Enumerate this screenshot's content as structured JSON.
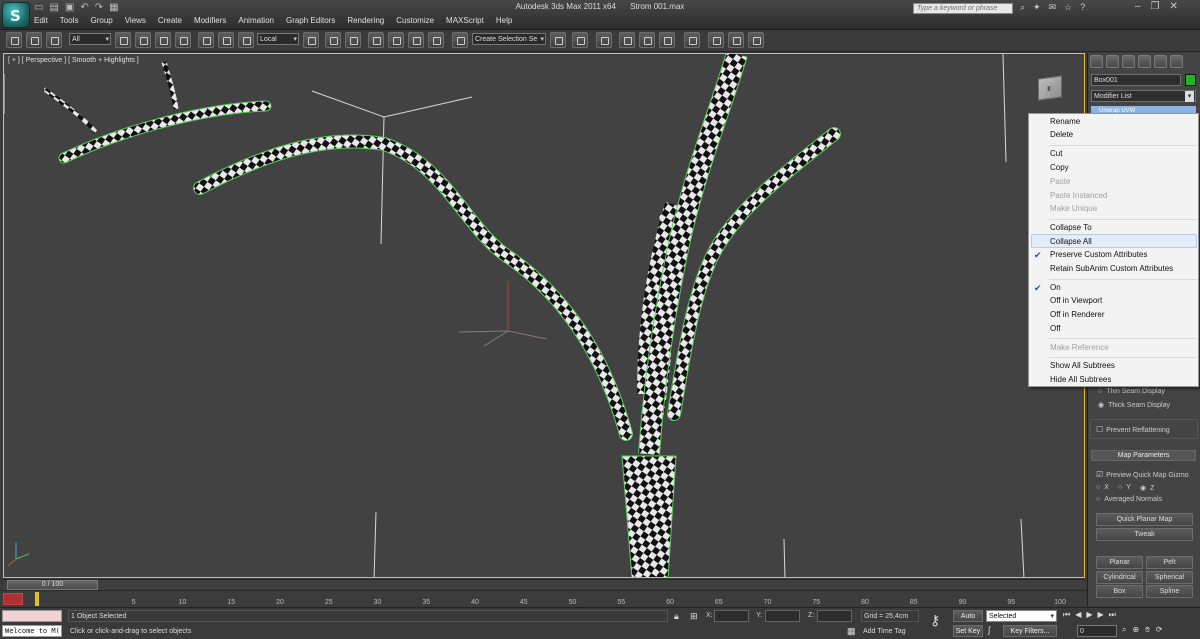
{
  "window": {
    "app_title": "Autodesk 3ds Max  2011 x64",
    "file_name": "Strom 001.max",
    "search_placeholder": "Type a keyword or phrase"
  },
  "menu": [
    "Edit",
    "Tools",
    "Group",
    "Views",
    "Create",
    "Modifiers",
    "Animation",
    "Graph Editors",
    "Rendering",
    "Customize",
    "MAXScript",
    "Help"
  ],
  "toolbar": {
    "selection_filter": "All",
    "reference_coord": "Local",
    "named_selection": "Create Selection Se"
  },
  "viewport": {
    "label": "[ + ] [ Perspective ] [ Smooth + Highlights ]"
  },
  "command_panel": {
    "object_name": "Box001",
    "object_color": "#22b422",
    "modifier_list": "Modifier List",
    "stack_item": "Unwrap UVW",
    "thin_seam": "Thin Seam Display",
    "thick_seam": "Thick Seam Display",
    "prevent_reflattening": "Prevent Reflattening",
    "map_parameters": "Map Parameters",
    "preview_gizmo": "Preview Quick Map Gizmo",
    "axis_x": "X",
    "axis_y": "Y",
    "axis_z": "Z",
    "averaged_normals": "Averaged Normals",
    "quick_planar_map": "Quick Planar Map",
    "tweak": "Tweak",
    "planar": "Planar",
    "pelt": "Pelt",
    "cylindrical": "Cylindrical",
    "spherical": "Spherical",
    "box": "Box",
    "spline": "Spline"
  },
  "context_menu": {
    "group1": [
      "Rename",
      "Delete"
    ],
    "group2": [
      {
        "label": "Cut",
        "disabled": false
      },
      {
        "label": "Copy",
        "disabled": false
      },
      {
        "label": "Paste",
        "disabled": true
      },
      {
        "label": "Paste Instanced",
        "disabled": true
      },
      {
        "label": "Make Unique",
        "disabled": true
      }
    ],
    "group3": [
      {
        "label": "Collapse To",
        "checked": false
      },
      {
        "label": "Collapse All",
        "checked": false
      },
      {
        "label": "Preserve Custom Attributes",
        "checked": true
      },
      {
        "label": "Retain SubAnim Custom Attributes",
        "checked": false
      }
    ],
    "group4": [
      {
        "label": "On",
        "checked": true
      },
      {
        "label": "Off in Viewport",
        "checked": false
      },
      {
        "label": "Off in Renderer",
        "checked": false
      },
      {
        "label": "Off",
        "checked": false
      }
    ],
    "make_reference": "Make Reference",
    "show_subtrees": "Show All Subtrees",
    "hide_subtrees": "Hide All Subtrees"
  },
  "timeline": {
    "time_slider": "0 / 100",
    "ticks": [
      "5",
      "10",
      "15",
      "20",
      "25",
      "30",
      "35",
      "40",
      "45",
      "50",
      "55",
      "60",
      "65",
      "70",
      "75",
      "80",
      "85",
      "90",
      "95",
      "100"
    ]
  },
  "status": {
    "maxscript_text": "Welcome to M(",
    "selected_count": "1 Object Selected",
    "prompt": "Click or click-and-drag to select objects",
    "x_label": "X:",
    "y_label": "Y:",
    "z_label": "Z:",
    "grid": "Grid = 25,4cm",
    "add_time_tag": "Add Time Tag",
    "auto_key": "Auto Key",
    "set_key": "Set Key",
    "selected_mode": "Selected",
    "key_filters": "Key Filters...",
    "current_frame": "0"
  }
}
